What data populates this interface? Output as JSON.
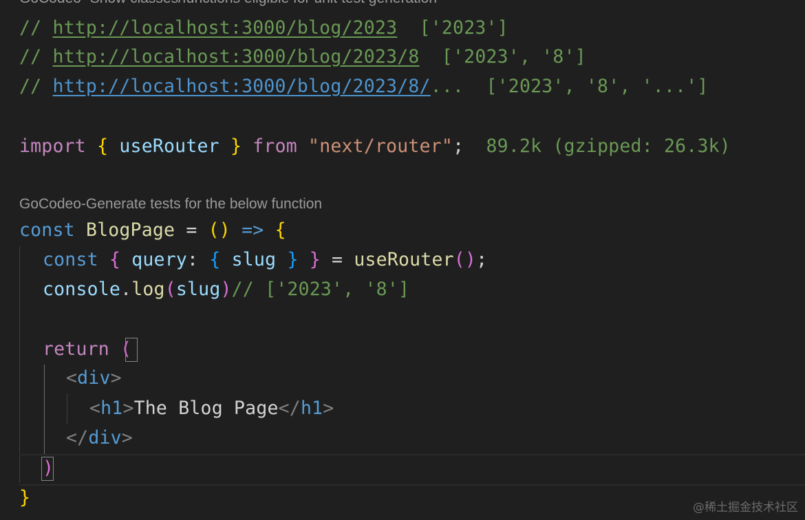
{
  "code_lens": {
    "top": "GoCodeo- Show classes/functions eligible for unit test generation",
    "function": "GoCodeo-Generate tests for the below function"
  },
  "comments": [
    {
      "prefix": "// ",
      "url": "http://localhost:3000/blog/2023",
      "params": "  ['2023']"
    },
    {
      "prefix": "// ",
      "url": "http://localhost:3000/blog/2023/8",
      "params": "  ['2023', '8']"
    },
    {
      "prefix": "// ",
      "url": "http://localhost:3000/blog/2023/8/",
      "rest": "...",
      "params": "  ['2023', '8', '...']"
    }
  ],
  "import_line": {
    "kw_import": "import",
    "brace_open": "{",
    "name": "useRouter",
    "brace_close": "}",
    "kw_from": "from",
    "module": "\"next/router\"",
    "semi": ";",
    "size": "  89.2k (gzipped: 26.3k)"
  },
  "blog_line": {
    "kw_const": "const",
    "name": "BlogPage",
    "eq": " = ",
    "parens": "()",
    "arrow": " => ",
    "brace": "{"
  },
  "query_line": {
    "kw_const": "const",
    "brace1_open": "{",
    "query": "query",
    "colon": ":",
    "brace2_open": "{",
    "slug": "slug",
    "brace2_close": "}",
    "brace1_close": "}",
    "eq": " = ",
    "fn": "useRouter",
    "parens": "()",
    "semi": ";"
  },
  "console_line": {
    "console": "console",
    "dot": ".",
    "log": "log",
    "paren_open": "(",
    "arg": "slug",
    "paren_close": ")",
    "comment": "// ['2023', '8']"
  },
  "return_line": {
    "kw": "return",
    "paren": "("
  },
  "jsx": {
    "div_open_lt": "<",
    "div_tag": "div",
    "div_open_gt": ">",
    "h1_lt": "<",
    "h1_tag": "h1",
    "h1_gt": ">",
    "h1_text": "The Blog Page",
    "h1_close_lt": "</",
    "h1_close_tag": "h1",
    "h1_close_gt": ">",
    "div_close_lt": "</",
    "div_close_tag": "div",
    "div_close_gt": ">"
  },
  "closing": {
    "paren": ")",
    "brace": "}"
  },
  "watermark": "@稀土掘金技术社区"
}
